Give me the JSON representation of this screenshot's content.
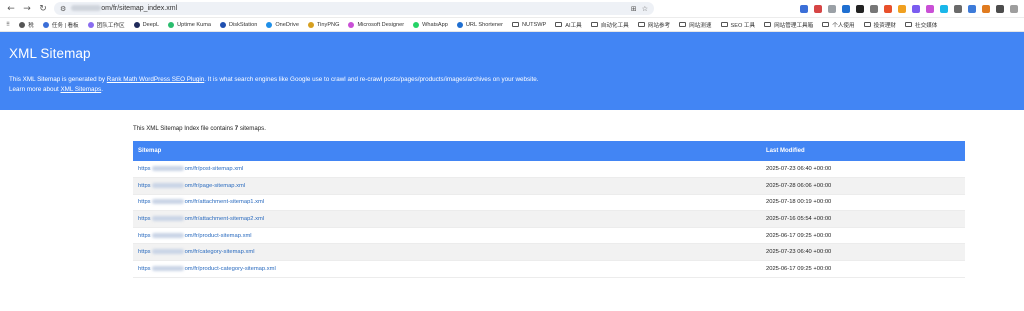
{
  "browser": {
    "url_prefix": "",
    "url_suffix": "om/fr/sitemap_index.xml",
    "bookmarks": [
      {
        "label": "税",
        "type": "icon"
      },
      {
        "label": "任务 | 看板",
        "type": "icon"
      },
      {
        "label": "团队工作区",
        "type": "icon"
      },
      {
        "label": "DeepL",
        "type": "icon"
      },
      {
        "label": "Uptime Kuma",
        "type": "icon"
      },
      {
        "label": "DiskStation",
        "type": "icon"
      },
      {
        "label": "OneDrive",
        "type": "icon"
      },
      {
        "label": "TinyPNG",
        "type": "icon"
      },
      {
        "label": "Microsoft Designer",
        "type": "icon"
      },
      {
        "label": "WhatsApp",
        "type": "icon"
      },
      {
        "label": "URL Shortener",
        "type": "icon"
      },
      {
        "label": "NUTSWP",
        "type": "folder"
      },
      {
        "label": "AI工具",
        "type": "folder"
      },
      {
        "label": "自动化工具",
        "type": "folder"
      },
      {
        "label": "网站参考",
        "type": "folder"
      },
      {
        "label": "网站测速",
        "type": "folder"
      },
      {
        "label": "SEO 工具",
        "type": "folder"
      },
      {
        "label": "网站管理工具箱",
        "type": "folder"
      },
      {
        "label": "个人使用",
        "type": "folder"
      },
      {
        "label": "投资理财",
        "type": "folder"
      },
      {
        "label": "社交媒体",
        "type": "folder"
      }
    ]
  },
  "header": {
    "title": "XML Sitemap",
    "desc_before": "This XML Sitemap is generated by ",
    "plugin_link": "Rank Math WordPress SEO Plugin",
    "desc_after": ". It is what search engines like Google use to crawl and re-crawl posts/pages/products/images/archives on your website.",
    "learn_before": "Learn more about ",
    "learn_link": "XML Sitemaps",
    "learn_after": "."
  },
  "content": {
    "intro_before": "This XML Sitemap Index file contains ",
    "intro_count": "7",
    "intro_after": " sitemaps.",
    "columns": {
      "sitemap": "Sitemap",
      "last_modified": "Last Modified"
    },
    "rows": [
      {
        "prefix": "https",
        "path": "om/fr/post-sitemap.xml",
        "modified": "2025-07-23 06:40 +00:00"
      },
      {
        "prefix": "https",
        "path": "om/fr/page-sitemap.xml",
        "modified": "2025-07-28 06:06 +00:00"
      },
      {
        "prefix": "https",
        "path": "om/fr/attachment-sitemap1.xml",
        "modified": "2025-07-18 00:19 +00:00"
      },
      {
        "prefix": "https",
        "path": "om/fr/attachment-sitemap2.xml",
        "modified": "2025-07-16 05:54 +00:00"
      },
      {
        "prefix": "https",
        "path": "om/fr/product-sitemap.xml",
        "modified": "2025-06-17 09:25 +00:00"
      },
      {
        "prefix": "https",
        "path": "om/fr/category-sitemap.xml",
        "modified": "2025-07-23 06:40 +00:00"
      },
      {
        "prefix": "https",
        "path": "om/fr/product-category-sitemap.xml",
        "modified": "2025-06-17 09:25 +00:00"
      }
    ]
  }
}
